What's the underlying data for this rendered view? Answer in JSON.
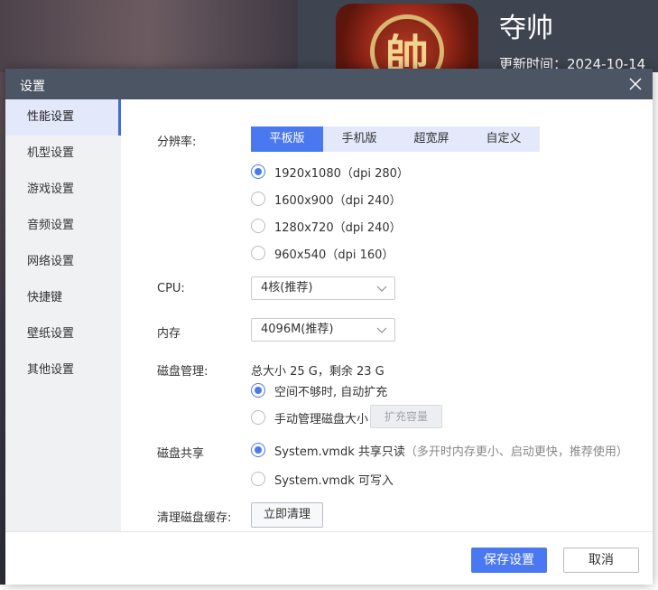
{
  "background": {
    "game_title": "夺帅",
    "game_icon_glyph": "帥",
    "update_time": "更新时间：2024-10-14"
  },
  "dialog": {
    "title": "设置",
    "close_icon": "close-icon"
  },
  "sidebar": {
    "items": [
      {
        "label": "性能设置",
        "active": true
      },
      {
        "label": "机型设置"
      },
      {
        "label": "游戏设置"
      },
      {
        "label": "音频设置"
      },
      {
        "label": "网络设置"
      },
      {
        "label": "快捷键"
      },
      {
        "label": "壁纸设置"
      },
      {
        "label": "其他设置"
      }
    ]
  },
  "performance": {
    "resolution": {
      "label": "分辨率:",
      "tabs": [
        "平板版",
        "手机版",
        "超宽屏",
        "自定义"
      ],
      "active_tab": "平板版",
      "options": [
        {
          "label": "1920x1080（dpi 280）",
          "selected": true
        },
        {
          "label": "1600x900（dpi 240）"
        },
        {
          "label": "1280x720（dpi 240）"
        },
        {
          "label": "960x540（dpi 160）"
        }
      ]
    },
    "cpu": {
      "label": "CPU:",
      "value": "4核(推荐)"
    },
    "memory": {
      "label": "内存",
      "value": "4096M(推荐)"
    },
    "disk": {
      "label": "磁盘管理:",
      "summary": "总大小 25 G，剩余 23 G",
      "options": [
        {
          "label": "空间不够时, 自动扩充",
          "selected": true
        },
        {
          "label": "手动管理磁盘大小"
        }
      ],
      "expand_button": "扩充容量"
    },
    "disk_share": {
      "label": "磁盘共享",
      "options": [
        {
          "label": "System.vmdk 共享只读",
          "hint": "（多开时内存更小、启动更快，推荐使用）",
          "selected": true
        },
        {
          "label": "System.vmdk 可写入"
        }
      ]
    },
    "cache": {
      "label": "清理磁盘缓存:",
      "button": "立即清理"
    }
  },
  "footer": {
    "save": "保存设置",
    "cancel": "取消"
  },
  "colors": {
    "accent": "#4a78f0",
    "titlebar": "#4c5563",
    "sidebar_bg": "#f0f1f3"
  }
}
